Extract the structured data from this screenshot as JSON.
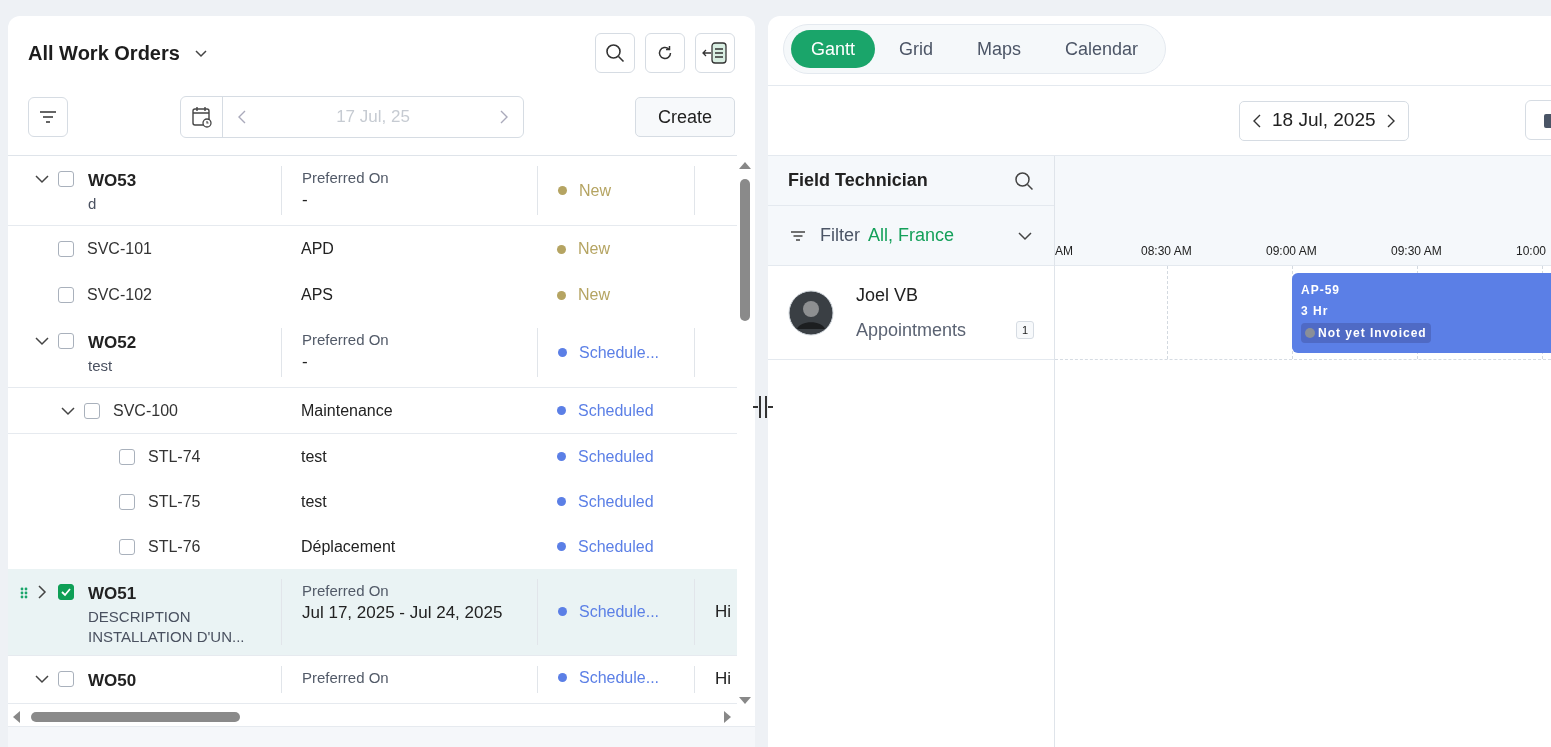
{
  "work_orders": {
    "view_title": "All Work Orders",
    "date": "17 Jul, 25",
    "create_label": "Create",
    "rows": [
      {
        "id": "WO53",
        "kind": "order",
        "expanded": true,
        "checked": false,
        "selected": false,
        "description": "d",
        "date_label": "Preferred On",
        "date_value": "-",
        "status": "New",
        "color": "#b5a462",
        "children": [
          {
            "id": "SVC-101",
            "kind": "service",
            "checked": false,
            "selected": false,
            "name": "APD",
            "status": "New",
            "color": "#b5a462"
          },
          {
            "id": "SVC-102",
            "kind": "service",
            "checked": false,
            "selected": false,
            "name": "APS",
            "status": "New",
            "color": "#b5a462"
          }
        ]
      },
      {
        "id": "WO52",
        "kind": "order",
        "expanded": true,
        "checked": false,
        "selected": false,
        "description": "test",
        "date_label": "Preferred On",
        "date_value": "-",
        "status": "Schedule...",
        "color": "#5b7fe6",
        "children": [
          {
            "id": "SVC-100",
            "kind": "service",
            "expanded": true,
            "checked": false,
            "selected": false,
            "name": "Maintenance",
            "status": "Scheduled",
            "color": "#5b7fe6",
            "children": [
              {
                "id": "STL-74",
                "kind": "service",
                "checked": false,
                "selected": false,
                "name": "test",
                "status": "Scheduled",
                "color": "#5b7fe6"
              },
              {
                "id": "STL-75",
                "kind": "service",
                "checked": false,
                "selected": false,
                "name": "test",
                "status": "Scheduled",
                "color": "#5b7fe6"
              },
              {
                "id": "STL-76",
                "kind": "service",
                "checked": false,
                "selected": false,
                "name": "Déplacement",
                "status": "Scheduled",
                "color": "#5b7fe6"
              }
            ]
          }
        ]
      },
      {
        "id": "WO51",
        "kind": "order",
        "expanded": false,
        "checked": true,
        "selected": true,
        "description": "DESCRIPTION INSTALLATION D'UN...",
        "date_label": "Preferred On",
        "date_value": "Jul 17, 2025 - Jul 24, 2025",
        "status": "Schedule...",
        "color": "#5b7fe6",
        "priority": "Hi"
      },
      {
        "id": "WO50",
        "kind": "order",
        "expanded": true,
        "checked": false,
        "selected": false,
        "date_label": "Preferred On",
        "status": "Schedule...",
        "color": "#5b7fe6",
        "priority": "Hi"
      }
    ]
  },
  "scheduler": {
    "tabs": [
      {
        "label": "Gantt",
        "selected": true
      },
      {
        "label": "Grid",
        "selected": false
      },
      {
        "label": "Maps",
        "selected": false
      },
      {
        "label": "Calendar",
        "selected": false
      }
    ],
    "date": "18 Jul, 2025",
    "resource_header": "Field Technician",
    "filter": {
      "label": "Filter",
      "value": "All, France"
    },
    "time_ticks": [
      "AM",
      "08:30 AM",
      "09:00 AM",
      "09:30 AM",
      "10:00"
    ],
    "technicians": [
      {
        "name": "Joel VB",
        "subtitle": "Appointments",
        "count": "1",
        "appointments": [
          {
            "code": "AP-59",
            "duration": "3 Hr",
            "status": "Not yet Invoiced"
          }
        ]
      }
    ]
  }
}
